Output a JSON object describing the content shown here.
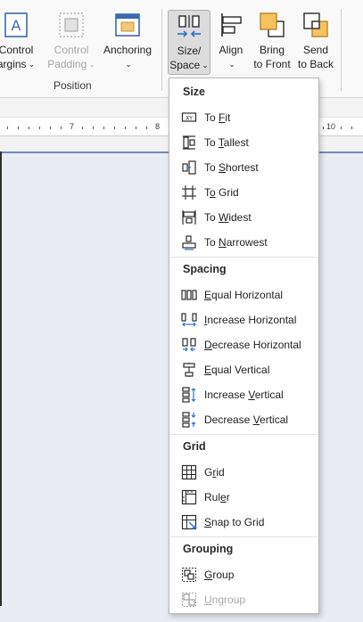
{
  "ribbon": {
    "control_margins": {
      "line1": "Control",
      "line2": "argins"
    },
    "control_padding": {
      "line1": "Control",
      "line2": "Padding"
    },
    "anchoring": {
      "label": "Anchoring"
    },
    "size_space": {
      "line1": "Size/",
      "line2": "Space"
    },
    "align": {
      "label": "Align"
    },
    "bring_to_front": {
      "line1": "Bring",
      "line2": "to Front"
    },
    "send_to_back": {
      "line1": "Send",
      "line2": "to Back"
    },
    "group_label": "Position",
    "chevron": "⌄"
  },
  "ruler": {
    "numbers": [
      "7",
      "8",
      "10"
    ]
  },
  "menu": {
    "size": {
      "title": "Size",
      "items": [
        {
          "pre": "To ",
          "key": "F",
          "post": "it"
        },
        {
          "pre": "To ",
          "key": "T",
          "post": "allest"
        },
        {
          "pre": "To ",
          "key": "S",
          "post": "hortest"
        },
        {
          "pre": "T",
          "key": "o",
          "post": " Grid"
        },
        {
          "pre": "To ",
          "key": "W",
          "post": "idest"
        },
        {
          "pre": "To ",
          "key": "N",
          "post": "arrowest"
        }
      ]
    },
    "spacing": {
      "title": "Spacing",
      "items": [
        {
          "pre": "",
          "key": "E",
          "post": "qual Horizontal"
        },
        {
          "pre": "",
          "key": "I",
          "post": "ncrease Horizontal"
        },
        {
          "pre": "",
          "key": "D",
          "post": "ecrease Horizontal"
        },
        {
          "pre": "",
          "key": "E",
          "post": "qual Vertical"
        },
        {
          "pre": "Increase ",
          "key": "V",
          "post": "ertical"
        },
        {
          "pre": "Decrease ",
          "key": "V",
          "post": "ertical"
        }
      ]
    },
    "grid": {
      "title": "Grid",
      "items": [
        {
          "pre": "G",
          "key": "r",
          "post": "id"
        },
        {
          "pre": "Rul",
          "key": "e",
          "post": "r"
        },
        {
          "pre": "",
          "key": "S",
          "post": "nap to Grid"
        }
      ]
    },
    "grouping": {
      "title": "Grouping",
      "items": [
        {
          "pre": "",
          "key": "G",
          "post": "roup"
        },
        {
          "pre": "",
          "key": "U",
          "post": "ngroup"
        }
      ]
    }
  },
  "colors": {
    "accent": "#2f6fc4",
    "icon": "#2b2b2b",
    "disabled": "#a9a9a9"
  }
}
